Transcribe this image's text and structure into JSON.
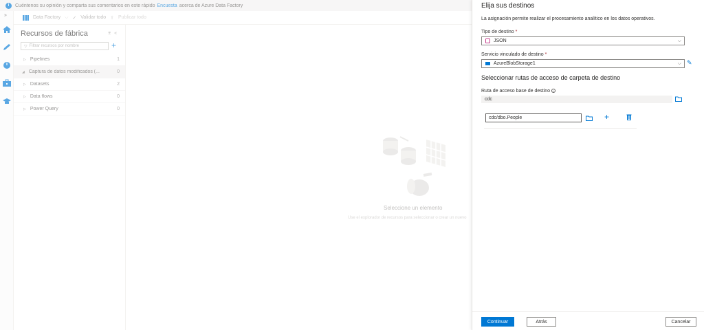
{
  "feedback": {
    "text_before": "Cuéntenos su opinión y comparta sus comentarios en este rápido",
    "link": "Encuesta",
    "text_after": "acerca de Azure Data Factory"
  },
  "toolbar": {
    "factory": "Data Factory",
    "validate": "Validar todo",
    "publish": "Publicar todo"
  },
  "resources": {
    "title": "Recursos de fábrica",
    "filter_placeholder": "Filtrar recursos por nombre",
    "items": [
      {
        "label": "Pipelines",
        "count": "1"
      },
      {
        "label": "Captura de datos modificados (...",
        "count": "0"
      },
      {
        "label": "Datasets",
        "count": "2"
      },
      {
        "label": "Data flows",
        "count": "0"
      },
      {
        "label": "Power Query",
        "count": "0"
      }
    ]
  },
  "canvas": {
    "empty_title": "Seleccione un elemento",
    "empty_sub": "Use el explorador de recursos para seleccionar o crear un nuevo"
  },
  "panel": {
    "title": "Elija sus destinos",
    "description": "La asignación permite realizar el procesamiento analítico en los datos operativos.",
    "target_type_label": "Tipo de destino",
    "target_type_value": "JSON",
    "linked_service_label": "Servicio vinculado de destino",
    "linked_service_value": "AzureBlobStorage1",
    "section_title": "Seleccionar rutas de acceso de carpeta de destino",
    "base_path_label": "Ruta de acceso base de destino",
    "base_path_value": "cdc",
    "folder_path_value": "cdc/dbo.People",
    "required_mark": "*",
    "continue_label": "Continuar",
    "back_label": "Atrás",
    "cancel_label": "Cancelar"
  },
  "colors": {
    "accent": "#0078d4"
  }
}
